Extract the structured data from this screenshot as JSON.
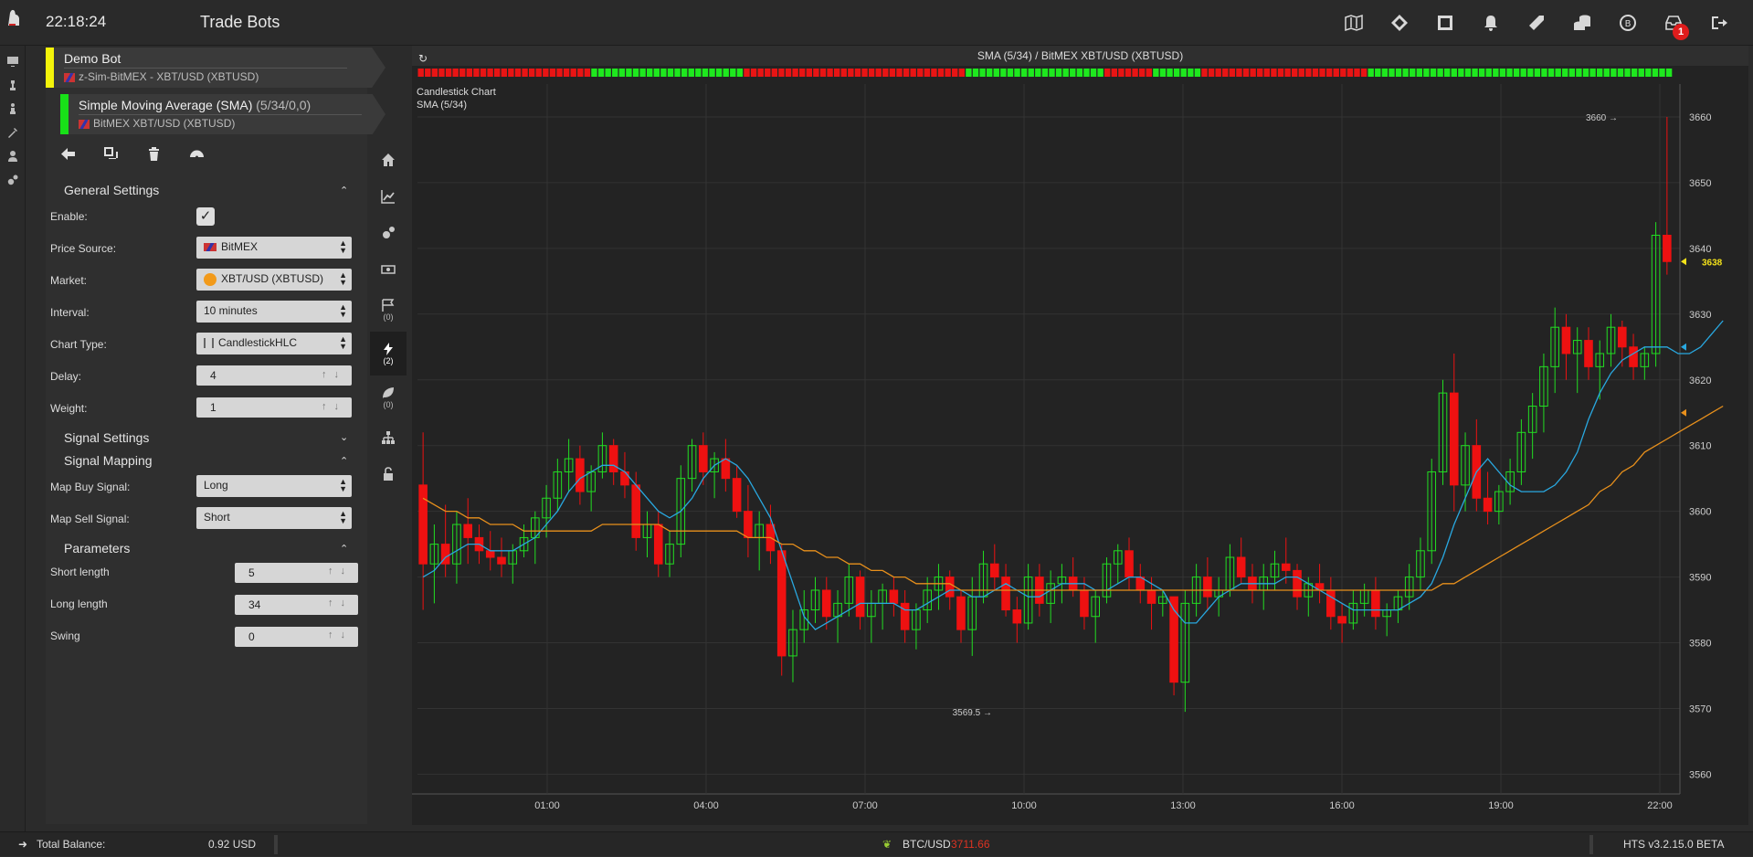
{
  "header": {
    "clock": "22:18:24",
    "title": "Trade Bots",
    "icons": [
      "map-icon",
      "ticket-icon",
      "expand-icon",
      "bell-icon",
      "tag-icon",
      "coins-icon",
      "bitcoin-sync-icon",
      "inbox-icon",
      "logout-icon"
    ],
    "inbox_badge": "1"
  },
  "left_rail": [
    "monitor-icon",
    "chess-icon",
    "chess-piece-icon",
    "tools-icon",
    "user-icon",
    "settings-icon"
  ],
  "bots": [
    {
      "name": "Demo Bot",
      "sub": "z-Sim-BitMEX - XBT/USD (XBTUSD)",
      "color": "#f4f40a"
    },
    {
      "name": "Simple Moving Average (SMA)",
      "params": "(5/34/0,0)",
      "sub": "BitMEX XBT/USD (XBTUSD)",
      "color": "#18e018"
    }
  ],
  "general": {
    "title": "General Settings",
    "enable_label": "Enable:",
    "enable_checked": true,
    "price_source_label": "Price Source:",
    "price_source": "BitMEX",
    "market_label": "Market:",
    "market": "XBT/USD (XBTUSD)",
    "interval_label": "Interval:",
    "interval": "10 minutes",
    "chart_type_label": "Chart Type:",
    "chart_type": "CandlestickHLC",
    "delay_label": "Delay:",
    "delay": "4",
    "weight_label": "Weight:",
    "weight": "1"
  },
  "signal_settings": {
    "title": "Signal Settings"
  },
  "signal_mapping": {
    "title": "Signal Mapping",
    "buy_label": "Map Buy Signal:",
    "buy": "Long",
    "sell_label": "Map Sell Signal:",
    "sell": "Short"
  },
  "parameters": {
    "title": "Parameters",
    "short_label": "Short length",
    "short": "5",
    "long_label": "Long length",
    "long": "34",
    "swing_label": "Swing",
    "swing": "0"
  },
  "side_tabs": [
    {
      "icon": "home-icon",
      "count": ""
    },
    {
      "icon": "chart-line-icon",
      "count": ""
    },
    {
      "icon": "gears-icon",
      "count": ""
    },
    {
      "icon": "money-icon",
      "count": ""
    },
    {
      "icon": "flags-icon",
      "count": "(0)"
    },
    {
      "icon": "bolt-icon",
      "count": "(2)"
    },
    {
      "icon": "leaf-icon",
      "count": "(0)"
    },
    {
      "icon": "sitemap-icon",
      "count": ""
    },
    {
      "icon": "unlock-icon",
      "count": ""
    }
  ],
  "chart": {
    "header": "SMA (5/34) / BitMEX XBT/USD (XBTUSD)",
    "label1": "Candlestick Chart",
    "label2": "SMA (5/34)",
    "high_marker": "3660",
    "low_marker": "3569.5",
    "last_price": "3638",
    "colors": {
      "up": "#22dd22",
      "down": "#ee1111",
      "sma_short": "#29a8e0",
      "sma_long": "#e8901c"
    }
  },
  "chart_data": {
    "type": "line",
    "title": "SMA (5/34) / BitMEX XBT/USD (XBTUSD)",
    "xlabel": "",
    "ylabel": "",
    "x_ticks": [
      "01:00",
      "04:00",
      "07:00",
      "10:00",
      "13:00",
      "16:00",
      "19:00",
      "22:00"
    ],
    "y_ticks": [
      3560,
      3570,
      3580,
      3590,
      3600,
      3610,
      3620,
      3630,
      3640,
      3650,
      3660
    ],
    "ylim": [
      3557,
      3665
    ],
    "signal_strip": [
      "r",
      "r",
      "r",
      "r",
      "r",
      "r",
      "r",
      "r",
      "r",
      "r",
      "r",
      "r",
      "r",
      "r",
      "r",
      "r",
      "r",
      "r",
      "r",
      "r",
      "r",
      "r",
      "r",
      "r",
      "r",
      "g",
      "g",
      "g",
      "g",
      "g",
      "g",
      "g",
      "g",
      "g",
      "g",
      "g",
      "g",
      "g",
      "g",
      "g",
      "g",
      "g",
      "g",
      "g",
      "g",
      "g",
      "g",
      "r",
      "r",
      "r",
      "r",
      "r",
      "r",
      "r",
      "r",
      "r",
      "r",
      "r",
      "r",
      "r",
      "r",
      "r",
      "r",
      "r",
      "r",
      "r",
      "r",
      "r",
      "r",
      "r",
      "r",
      "r",
      "r",
      "r",
      "r",
      "r",
      "r",
      "r",
      "r",
      "g",
      "g",
      "g",
      "g",
      "g",
      "g",
      "g",
      "g",
      "g",
      "g",
      "g",
      "g",
      "g",
      "g",
      "g",
      "g",
      "g",
      "g",
      "g",
      "g",
      "r",
      "r",
      "r",
      "r",
      "r",
      "r",
      "r",
      "g",
      "g",
      "g",
      "g",
      "g",
      "g",
      "g",
      "r",
      "r",
      "r",
      "r",
      "r",
      "r",
      "r",
      "r",
      "r",
      "r",
      "r",
      "r",
      "r",
      "r",
      "r",
      "r",
      "r",
      "r",
      "r",
      "r",
      "r",
      "r",
      "r",
      "r",
      "g",
      "g",
      "g",
      "g",
      "g",
      "g",
      "g",
      "g",
      "g",
      "g",
      "g",
      "g",
      "g",
      "g",
      "g",
      "g",
      "g",
      "g",
      "g",
      "g",
      "g",
      "g",
      "g",
      "g",
      "g",
      "g",
      "g",
      "g",
      "g",
      "g",
      "g",
      "g",
      "g",
      "g",
      "g",
      "g",
      "g",
      "g",
      "g",
      "g",
      "g",
      "g",
      "g",
      "g"
    ],
    "candles": [
      [
        3604,
        3612,
        3585,
        3592
      ],
      [
        3592,
        3598,
        3586,
        3595
      ],
      [
        3595,
        3601,
        3590,
        3592
      ],
      [
        3592,
        3600,
        3589,
        3598
      ],
      [
        3598,
        3602,
        3592,
        3596
      ],
      [
        3596,
        3598,
        3592,
        3594
      ],
      [
        3594,
        3597,
        3591,
        3593
      ],
      [
        3593,
        3596,
        3590,
        3592
      ],
      [
        3592,
        3595,
        3589,
        3594
      ],
      [
        3594,
        3598,
        3593,
        3596
      ],
      [
        3596,
        3600,
        3592,
        3599
      ],
      [
        3599,
        3604,
        3596,
        3602
      ],
      [
        3602,
        3608,
        3600,
        3606
      ],
      [
        3606,
        3611,
        3603,
        3608
      ],
      [
        3608,
        3610,
        3601,
        3603
      ],
      [
        3603,
        3607,
        3600,
        3606
      ],
      [
        3606,
        3612,
        3605,
        3610
      ],
      [
        3610,
        3611,
        3604,
        3606
      ],
      [
        3606,
        3609,
        3602,
        3604
      ],
      [
        3604,
        3606,
        3594,
        3596
      ],
      [
        3596,
        3600,
        3593,
        3598
      ],
      [
        3598,
        3600,
        3590,
        3592
      ],
      [
        3592,
        3597,
        3590,
        3595
      ],
      [
        3595,
        3607,
        3593,
        3605
      ],
      [
        3605,
        3611,
        3603,
        3610
      ],
      [
        3610,
        3612,
        3604,
        3606
      ],
      [
        3606,
        3609,
        3602,
        3608
      ],
      [
        3608,
        3611,
        3603,
        3605
      ],
      [
        3605,
        3607,
        3599,
        3600
      ],
      [
        3600,
        3604,
        3593,
        3596
      ],
      [
        3596,
        3600,
        3591,
        3598
      ],
      [
        3598,
        3601,
        3592,
        3594
      ],
      [
        3594,
        3595,
        3575,
        3578
      ],
      [
        3578,
        3585,
        3574,
        3582
      ],
      [
        3582,
        3588,
        3580,
        3585
      ],
      [
        3585,
        3590,
        3583,
        3588
      ],
      [
        3588,
        3590,
        3582,
        3584
      ],
      [
        3584,
        3588,
        3580,
        3586
      ],
      [
        3586,
        3592,
        3584,
        3590
      ],
      [
        3590,
        3591,
        3582,
        3584
      ],
      [
        3584,
        3588,
        3580,
        3586
      ],
      [
        3586,
        3589,
        3582,
        3588
      ],
      [
        3588,
        3590,
        3584,
        3586
      ],
      [
        3586,
        3588,
        3580,
        3582
      ],
      [
        3582,
        3586,
        3579,
        3585
      ],
      [
        3585,
        3590,
        3583,
        3588
      ],
      [
        3588,
        3592,
        3585,
        3590
      ],
      [
        3590,
        3591,
        3585,
        3587
      ],
      [
        3587,
        3588,
        3580,
        3582
      ],
      [
        3582,
        3590,
        3578,
        3587
      ],
      [
        3587,
        3594,
        3586,
        3592
      ],
      [
        3592,
        3595,
        3588,
        3590
      ],
      [
        3590,
        3592,
        3584,
        3585
      ],
      [
        3585,
        3587,
        3580,
        3583
      ],
      [
        3583,
        3592,
        3582,
        3590
      ],
      [
        3590,
        3592,
        3584,
        3586
      ],
      [
        3586,
        3591,
        3583,
        3589
      ],
      [
        3589,
        3592,
        3586,
        3590
      ],
      [
        3590,
        3593,
        3587,
        3588
      ],
      [
        3588,
        3590,
        3582,
        3584
      ],
      [
        3584,
        3588,
        3580,
        3587
      ],
      [
        3587,
        3593,
        3586,
        3592
      ],
      [
        3592,
        3595,
        3589,
        3594
      ],
      [
        3594,
        3596,
        3588,
        3590
      ],
      [
        3590,
        3592,
        3586,
        3588
      ],
      [
        3588,
        3590,
        3582,
        3586
      ],
      [
        3586,
        3588,
        3584,
        3587
      ],
      [
        3587,
        3587,
        3572,
        3574
      ],
      [
        3574,
        3588,
        3569.5,
        3586
      ],
      [
        3586,
        3592,
        3584,
        3590
      ],
      [
        3590,
        3593,
        3585,
        3587
      ],
      [
        3587,
        3590,
        3584,
        3588
      ],
      [
        3588,
        3595,
        3587,
        3593
      ],
      [
        3593,
        3596,
        3589,
        3590
      ],
      [
        3590,
        3592,
        3586,
        3588
      ],
      [
        3588,
        3592,
        3585,
        3590
      ],
      [
        3590,
        3594,
        3588,
        3592
      ],
      [
        3592,
        3596,
        3589,
        3591
      ],
      [
        3591,
        3592,
        3585,
        3587
      ],
      [
        3587,
        3590,
        3584,
        3589
      ],
      [
        3589,
        3592,
        3586,
        3588
      ],
      [
        3588,
        3590,
        3582,
        3584
      ],
      [
        3584,
        3586,
        3580,
        3583
      ],
      [
        3583,
        3588,
        3582,
        3586
      ],
      [
        3586,
        3589,
        3584,
        3588
      ],
      [
        3588,
        3590,
        3582,
        3584
      ],
      [
        3584,
        3586,
        3581,
        3585
      ],
      [
        3585,
        3588,
        3583,
        3587
      ],
      [
        3587,
        3592,
        3585,
        3590
      ],
      [
        3590,
        3596,
        3588,
        3594
      ],
      [
        3594,
        3608,
        3592,
        3606
      ],
      [
        3606,
        3620,
        3604,
        3618
      ],
      [
        3618,
        3624,
        3600,
        3604
      ],
      [
        3604,
        3612,
        3600,
        3610
      ],
      [
        3610,
        3614,
        3600,
        3602
      ],
      [
        3602,
        3606,
        3598,
        3600
      ],
      [
        3600,
        3604,
        3598,
        3603
      ],
      [
        3603,
        3608,
        3601,
        3606
      ],
      [
        3606,
        3614,
        3604,
        3612
      ],
      [
        3612,
        3618,
        3608,
        3616
      ],
      [
        3616,
        3624,
        3612,
        3622
      ],
      [
        3622,
        3631,
        3618,
        3628
      ],
      [
        3628,
        3630,
        3620,
        3624
      ],
      [
        3624,
        3628,
        3618,
        3626
      ],
      [
        3626,
        3628,
        3620,
        3622
      ],
      [
        3622,
        3626,
        3617,
        3624
      ],
      [
        3624,
        3630,
        3622,
        3628
      ],
      [
        3628,
        3629,
        3622,
        3625
      ],
      [
        3625,
        3627,
        3620,
        3622
      ],
      [
        3622,
        3625,
        3620,
        3624
      ],
      [
        3624,
        3644,
        3622,
        3642
      ],
      [
        3642,
        3660,
        3636,
        3638
      ]
    ],
    "series": [
      {
        "name": "SMA short",
        "values": [
          3590,
          3591,
          3593,
          3594,
          3595,
          3595,
          3594,
          3594,
          3594,
          3595,
          3596,
          3598,
          3600,
          3603,
          3605,
          3606,
          3607,
          3607,
          3606,
          3604,
          3602,
          3600,
          3599,
          3600,
          3602,
          3605,
          3607,
          3608,
          3607,
          3605,
          3602,
          3599,
          3594,
          3589,
          3584,
          3582,
          3583,
          3584,
          3585,
          3586,
          3586,
          3586,
          3586,
          3585,
          3585,
          3586,
          3587,
          3588,
          3588,
          3587,
          3587,
          3588,
          3589,
          3588,
          3587,
          3587,
          3588,
          3589,
          3589,
          3589,
          3588,
          3588,
          3589,
          3590,
          3590,
          3589,
          3588,
          3585,
          3583,
          3583,
          3585,
          3587,
          3588,
          3589,
          3589,
          3589,
          3589,
          3590,
          3590,
          3589,
          3588,
          3587,
          3586,
          3585,
          3585,
          3585,
          3585,
          3585,
          3586,
          3587,
          3589,
          3593,
          3598,
          3602,
          3606,
          3608,
          3606,
          3604,
          3603,
          3603,
          3603,
          3604,
          3606,
          3609,
          3614,
          3618,
          3621,
          3623,
          3624,
          3625,
          3625,
          3625,
          3624,
          3624,
          3625,
          3627,
          3629
        ]
      },
      {
        "name": "SMA long",
        "values": [
          3602,
          3601,
          3600,
          3600,
          3599,
          3599,
          3598,
          3598,
          3598,
          3597,
          3597,
          3597,
          3597,
          3597,
          3597,
          3597,
          3598,
          3598,
          3598,
          3598,
          3598,
          3598,
          3597,
          3597,
          3597,
          3597,
          3597,
          3597,
          3597,
          3596,
          3596,
          3596,
          3595,
          3595,
          3594,
          3594,
          3593,
          3593,
          3592,
          3592,
          3591,
          3591,
          3590,
          3590,
          3589,
          3589,
          3589,
          3589,
          3588,
          3588,
          3588,
          3588,
          3588,
          3588,
          3588,
          3588,
          3588,
          3588,
          3588,
          3588,
          3588,
          3588,
          3588,
          3588,
          3588,
          3588,
          3588,
          3588,
          3588,
          3588,
          3588,
          3588,
          3588,
          3588,
          3588,
          3588,
          3588,
          3588,
          3588,
          3588,
          3588,
          3588,
          3588,
          3588,
          3588,
          3588,
          3588,
          3588,
          3588,
          3588,
          3588,
          3589,
          3589,
          3590,
          3591,
          3592,
          3593,
          3594,
          3595,
          3596,
          3597,
          3598,
          3599,
          3600,
          3601,
          3603,
          3604,
          3606,
          3607,
          3609,
          3610,
          3611,
          3612,
          3613,
          3614,
          3615,
          3616
        ]
      }
    ]
  },
  "status": {
    "balance_label": "Total Balance:",
    "balance": "0.92 USD",
    "ticker_label": "BTC/USD",
    "ticker_value": "3711.66",
    "version": "HTS v3.2.15.0 BETA"
  }
}
